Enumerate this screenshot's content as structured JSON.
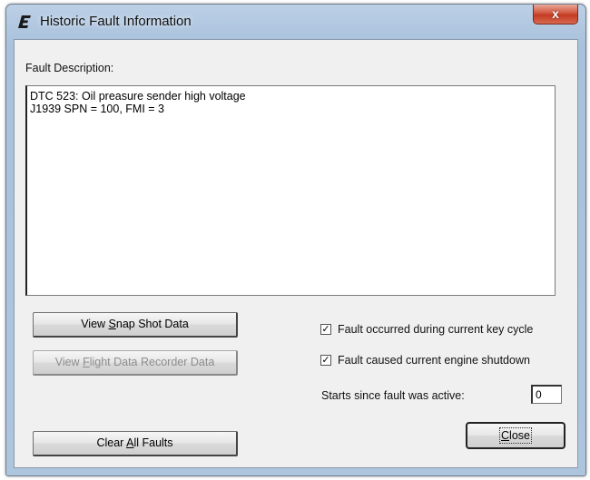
{
  "window": {
    "title": "Historic Fault Information",
    "close_glyph": "x",
    "app_icon": "e-logo-icon"
  },
  "fault_description": {
    "label": "Fault Description:",
    "lines": [
      "DTC 523: Oil preasure sender high voltage",
      "J1939 SPN = 100, FMI = 3"
    ]
  },
  "buttons": {
    "snapshot": {
      "prefix": "View ",
      "accel": "S",
      "rest": "nap Shot Data"
    },
    "flight": {
      "prefix": "View ",
      "accel": "F",
      "rest": "light Data Recorder Data"
    },
    "clear": {
      "prefix": "Clear ",
      "accel": "A",
      "rest": "ll Faults"
    },
    "close": {
      "prefix": "",
      "accel": "C",
      "rest": "lose"
    }
  },
  "checkboxes": [
    {
      "label": "Fault occurred during current key cycle",
      "checked": true
    },
    {
      "label": "Fault caused current engine shutdown",
      "checked": true
    }
  ],
  "starts_since": {
    "label": "Starts since fault was active:",
    "value": "0"
  },
  "colors": {
    "titlebar": "#a9c1dc",
    "close_button": "#c33a22",
    "dialog_face": "#f0f0f0"
  }
}
